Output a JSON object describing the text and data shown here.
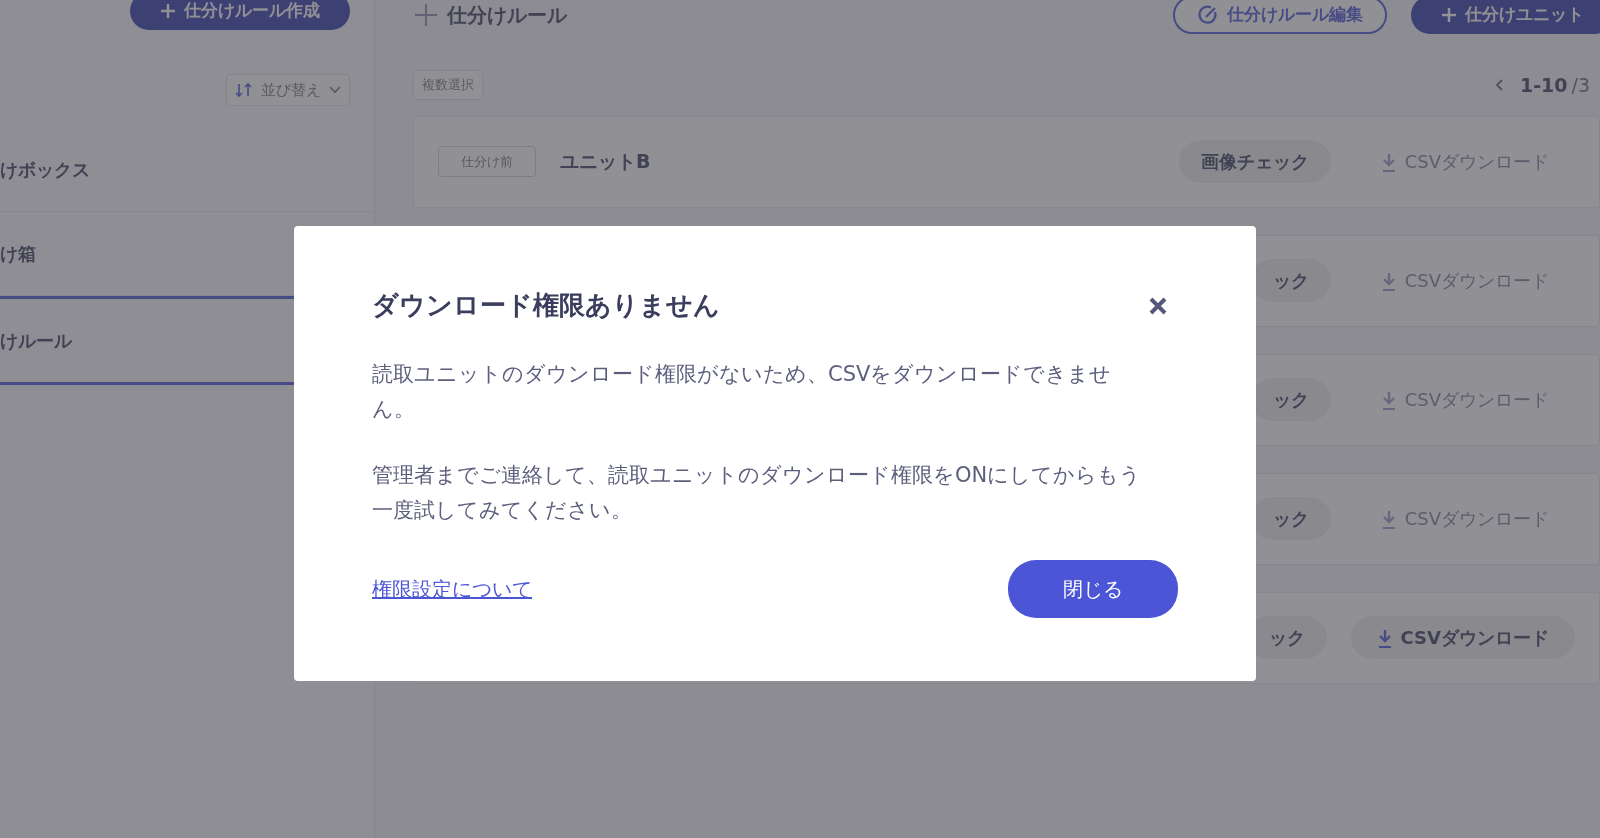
{
  "sidebar": {
    "create_button": "仕分けルール作成",
    "sort_button": "並び替え",
    "items": [
      {
        "label": "けボックス",
        "selected": false
      },
      {
        "label": "け箱",
        "selected": false
      },
      {
        "label": "けルール",
        "selected": true
      }
    ]
  },
  "main": {
    "title": "仕分けルール",
    "edit_button": "仕分けルール編集",
    "create_unit_button": "仕分けユニット",
    "multi_select_button": "複数選択",
    "pagination": {
      "range": "1-10",
      "total": "/3"
    },
    "rows": [
      {
        "tag": "仕分け前",
        "name": "ユニットB",
        "check_button": "画像チェック",
        "csv_button": "CSVダウンロード",
        "disabled": true
      },
      {
        "check_button": "ック",
        "csv_button": "CSVダウンロード",
        "disabled": true
      },
      {
        "check_button": "ック",
        "csv_button": "CSVダウンロード",
        "disabled": true
      },
      {
        "check_button": "ック",
        "csv_button": "CSVダウンロード",
        "disabled": true
      },
      {
        "check_button": "ック",
        "csv_button": "CSVダウンロード",
        "disabled": false
      }
    ]
  },
  "modal": {
    "title": "ダウンロード権限ありません",
    "paragraphs": [
      "読取ユニットのダウンロード権限がないため、CSVをダウンロードできません。",
      "管理者までご連絡して、読取ユニットのダウンロード権限をONにしてからもう一度試してみてください。"
    ],
    "link": "権限設定について",
    "close_button": "閉じる"
  }
}
